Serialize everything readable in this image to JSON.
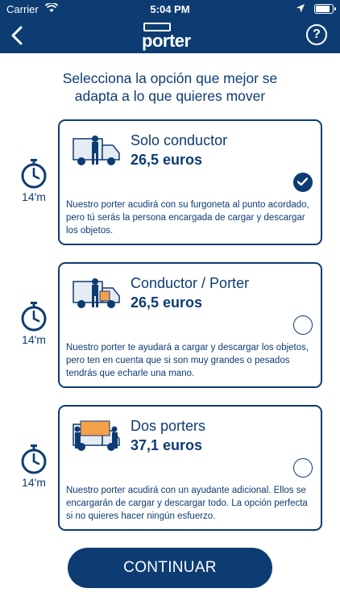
{
  "status_bar": {
    "carrier": "Carrier",
    "time": "5:04 PM",
    "battery_level": 0.9
  },
  "nav": {
    "logo": "porter"
  },
  "title": {
    "line1": "Selecciona la opción que mejor se",
    "line2": "adapta a lo que quieres mover"
  },
  "options": [
    {
      "name": "Solo conductor",
      "price": "26,5 euros",
      "time": "14'm",
      "selected": true,
      "description": "Nuestro porter acudirá con su furgoneta al punto acordado, pero tú serás la persona encargada de cargar y descargar los objetos."
    },
    {
      "name": "Conductor / Porter",
      "price": "26,5 euros",
      "time": "14'm",
      "selected": false,
      "description": "Nuestro porter te ayudará a cargar y descargar los objetos, pero ten en cuenta que si son muy grandes o pesados tendrás que echarle una mano."
    },
    {
      "name": "Dos porters",
      "price": "37,1 euros",
      "time": "14'm",
      "selected": false,
      "description": "Nuestro porter acudirá con un ayudante adicional. Ellos se encargarán de cargar y descargar todo. La opción perfecta si no quieres hacer ningún esfuerzo."
    }
  ],
  "continue_label": "CONTINUAR",
  "colors": {
    "primary": "#0d3c73",
    "accent_orange": "#f5a04a",
    "truck_light": "#e6ecf3"
  }
}
